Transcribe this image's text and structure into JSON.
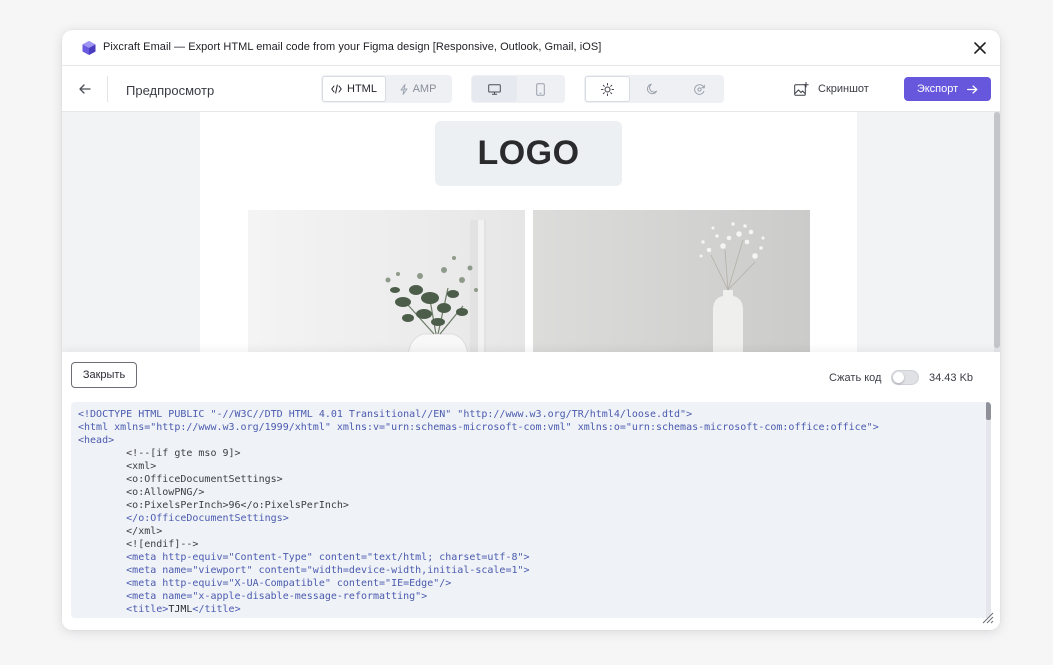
{
  "window": {
    "title": "Pixcraft Email — Export HTML email code from your Figma design [Responsive, Outlook, Gmail, iOS]",
    "close_icon": "close-icon"
  },
  "toolbar": {
    "back_icon": "arrow-left-icon",
    "title": "Предпросмотр",
    "format_tabs": [
      {
        "label": "HTML",
        "icon": "code-icon",
        "active": true
      },
      {
        "label": "AMP",
        "icon": "lightning-icon",
        "active": false
      }
    ],
    "device_tabs": [
      {
        "name": "desktop",
        "icon": "monitor-icon",
        "active": true
      },
      {
        "name": "mobile",
        "icon": "phone-icon",
        "active": false
      }
    ],
    "theme_tabs": [
      {
        "name": "light",
        "icon": "sun-icon",
        "active": true
      },
      {
        "name": "dark",
        "icon": "moon-icon",
        "active": false
      },
      {
        "name": "auto",
        "icon": "theme-auto-icon",
        "active": false
      }
    ],
    "screenshot_label": "Скриншот",
    "export_label": "Экспорт"
  },
  "preview": {
    "logo_text": "LOGO"
  },
  "code_panel": {
    "close_label": "Закрыть",
    "compress_label": "Сжать код",
    "compress_enabled": false,
    "size": "34.43 Kb",
    "lines": [
      "<!DOCTYPE HTML PUBLIC \"-//W3C//DTD HTML 4.01 Transitional//EN\" \"http://www.w3.org/TR/html4/loose.dtd\">",
      "<html xmlns=\"http://www.w3.org/1999/xhtml\" xmlns:v=\"urn:schemas-microsoft-com:vml\" xmlns:o=\"urn:schemas-microsoft-com:office:office\">",
      "<head>",
      "        <!--[if gte mso 9]>",
      "        <xml>",
      "        <o:OfficeDocumentSettings>",
      "        <o:AllowPNG/>",
      "        <o:PixelsPerInch>96</o:PixelsPerInch>",
      "        </o:OfficeDocumentSettings>",
      "        </xml>",
      "        <![endif]-->",
      "        <meta http-equiv=\"Content-Type\" content=\"text/html; charset=utf-8\">",
      "        <meta name=\"viewport\" content=\"width=device-width,initial-scale=1\">",
      "        <meta http-equiv=\"X-UA-Compatible\" content=\"IE=Edge\"/>",
      "        <meta name=\"x-apple-disable-message-reformatting\">",
      "        <title>TJML</title>"
    ]
  },
  "colors": {
    "accent": "#6657dd",
    "code_tag": "#4b5bb0",
    "code_background": "#eff2f6"
  }
}
